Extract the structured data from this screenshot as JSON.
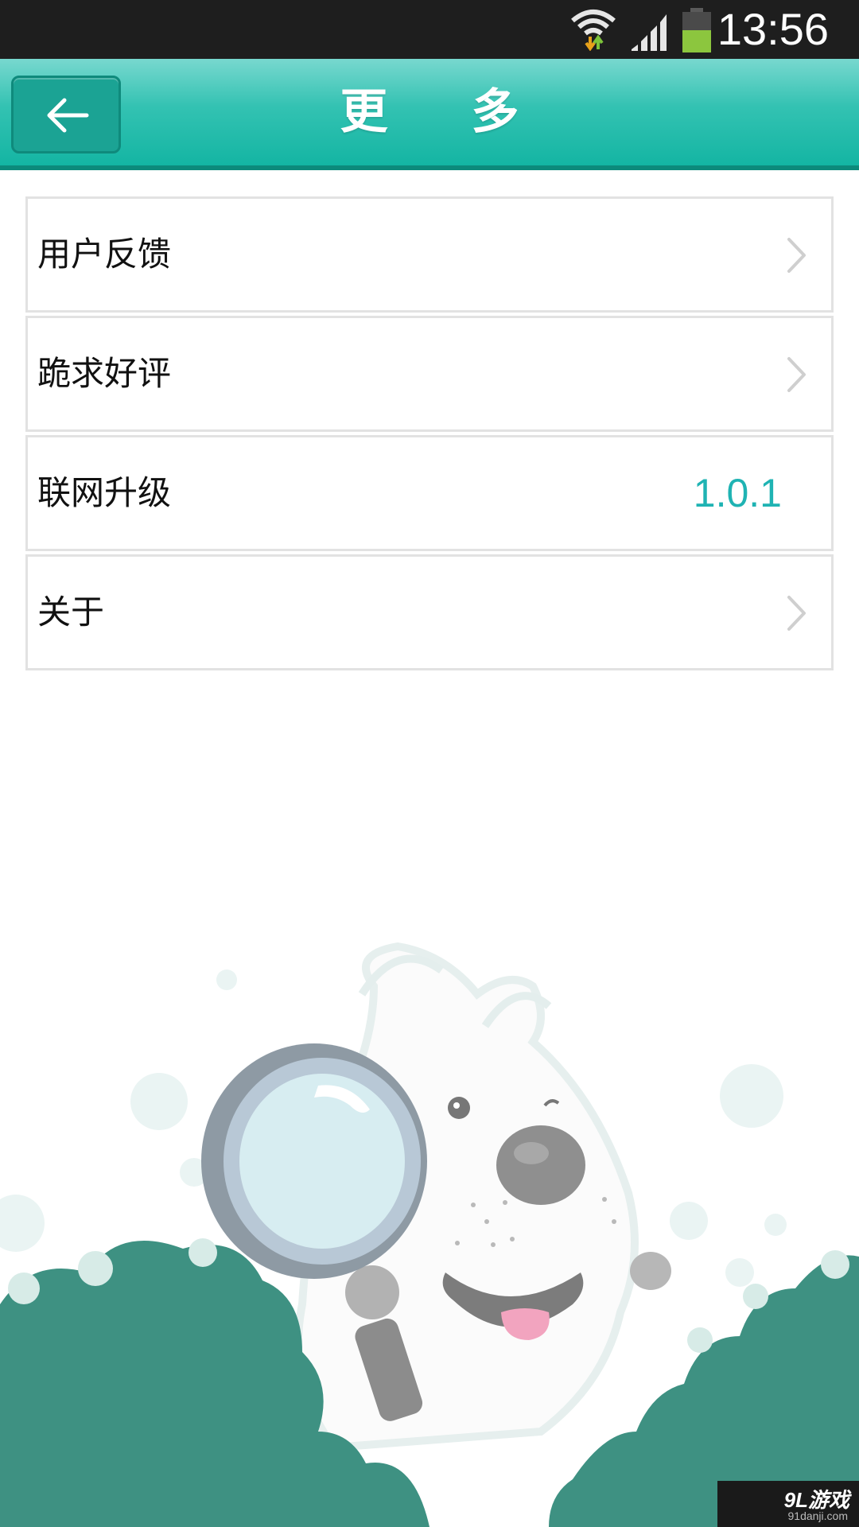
{
  "status_bar": {
    "time": "13:56",
    "icons": [
      "wifi-icon",
      "signal-icon",
      "battery-icon"
    ],
    "battery_color": "#8cc63e"
  },
  "header": {
    "title": "更 多",
    "back_icon": "arrow-left-icon",
    "accent_color": "#1ab5a3"
  },
  "menu": {
    "items": [
      {
        "label": "用户反馈",
        "icon": "chevron-right-icon"
      },
      {
        "label": "跪求好评",
        "icon": "chevron-right-icon"
      },
      {
        "label": "联网升级",
        "value": "1.0.1"
      },
      {
        "label": "关于",
        "icon": "chevron-right-icon"
      }
    ],
    "value_color": "#1fb3b3"
  },
  "illustration": {
    "subject": "dog-mascot-with-magnifier"
  },
  "watermark": {
    "logo_text": "9L游戏",
    "url_text": "91danji.com"
  }
}
